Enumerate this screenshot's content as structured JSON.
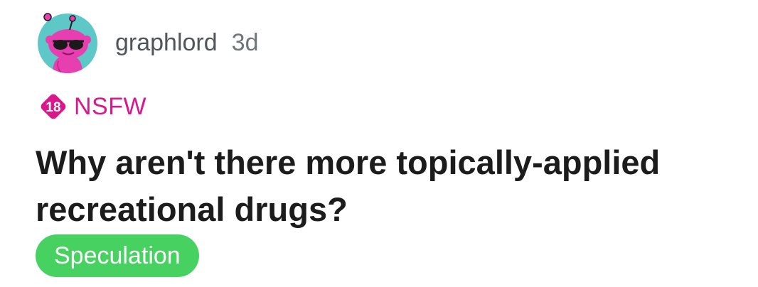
{
  "post": {
    "author": "graphlord",
    "age": "3d",
    "nsfw_badge_number": "18",
    "nsfw_label": "NSFW",
    "title": "Why aren't there more topically-applied recreational drugs?",
    "flair": "Speculation"
  },
  "colors": {
    "avatar_background": "#5ec8c8",
    "avatar_body": "#e83fb0",
    "nsfw": "#d8188b",
    "flair_background": "#46d160",
    "title_text": "#1c1c1c"
  },
  "icons": {
    "avatar": "snoo-avatar-with-sunglasses",
    "nsfw_badge": "nsfw-18-diamond-icon"
  }
}
